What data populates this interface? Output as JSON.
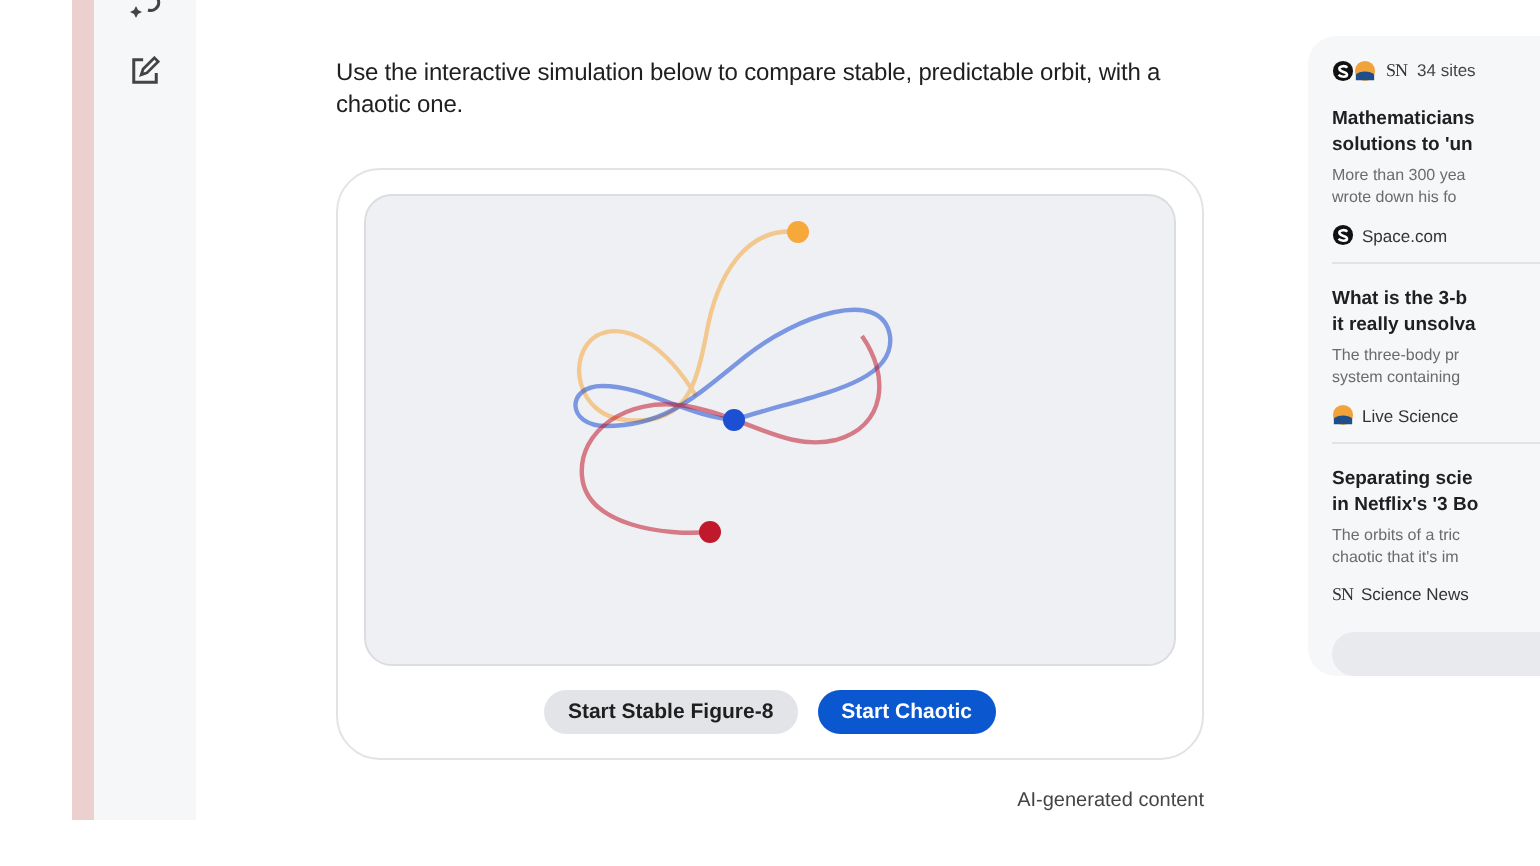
{
  "intro": "Use the interactive simulation below to compare stable, predictable orbit, with a chaotic one.",
  "simulation": {
    "bodies": [
      {
        "color": "#f6a83a"
      },
      {
        "color": "#1c4fd1"
      },
      {
        "color": "#c0192b"
      }
    ],
    "buttons": [
      {
        "label": "Start Stable Figure-8",
        "selected": false
      },
      {
        "label": "Start Chaotic",
        "selected": true
      }
    ]
  },
  "footer_note": "AI-generated content",
  "sources_panel": {
    "count": "34 sites",
    "header_logo_text": "SN",
    "items": [
      {
        "title_lines": [
          "Mathematicians",
          "solutions to 'un"
        ],
        "snippet_lines": [
          "More than 300 yea",
          "wrote down his fo"
        ],
        "source": {
          "kind": "circle-s",
          "name": "Space.com"
        }
      },
      {
        "title_lines": [
          "What is the 3-b",
          "it really unsolva"
        ],
        "snippet_lines": [
          "The three-body pr",
          "system containing"
        ],
        "source": {
          "kind": "orange-mark",
          "name": "Live Science"
        }
      },
      {
        "title_lines": [
          "Separating scie",
          "in Netflix's '3 Bo"
        ],
        "snippet_lines": [
          "The orbits of a tric",
          "chaotic that it's im"
        ],
        "source": {
          "kind": "letters",
          "logo_text": "SN",
          "name": "Science News"
        }
      }
    ]
  }
}
